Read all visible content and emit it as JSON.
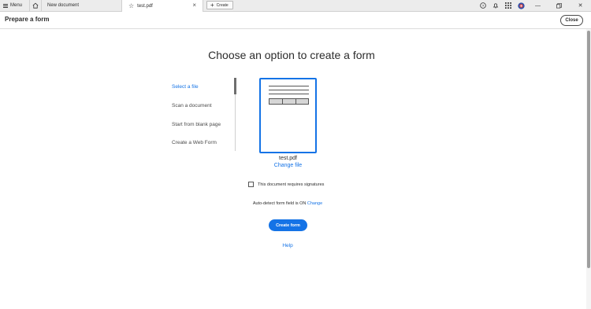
{
  "tabbar": {
    "menu_label": "Menu",
    "tabs": [
      {
        "label": "New document"
      },
      {
        "label": "test.pdf"
      }
    ],
    "create_label": "Create",
    "icons": [
      "help-icon",
      "bell-icon",
      "apps-grid-icon",
      "avatar"
    ]
  },
  "header": {
    "title": "Prepare a form",
    "close_label": "Close"
  },
  "main": {
    "title": "Choose an option to create a form",
    "options": [
      {
        "label": "Select a file",
        "active": true
      },
      {
        "label": "Scan a document",
        "active": false
      },
      {
        "label": "Start from blank page",
        "active": false
      },
      {
        "label": "Create a Web Form",
        "active": false
      }
    ],
    "file_name": "test.pdf",
    "change_file_label": "Change file",
    "signature_label": "This document requires signatures",
    "signature_checked": false,
    "auto_detect_text": "Auto-detect form field is ON",
    "auto_detect_link": "Change",
    "create_button_label": "Create form",
    "help_label": "Help"
  },
  "colors": {
    "accent": "#1473e6",
    "text": "#2c2c2c",
    "tabbar_bg": "#ececec"
  }
}
